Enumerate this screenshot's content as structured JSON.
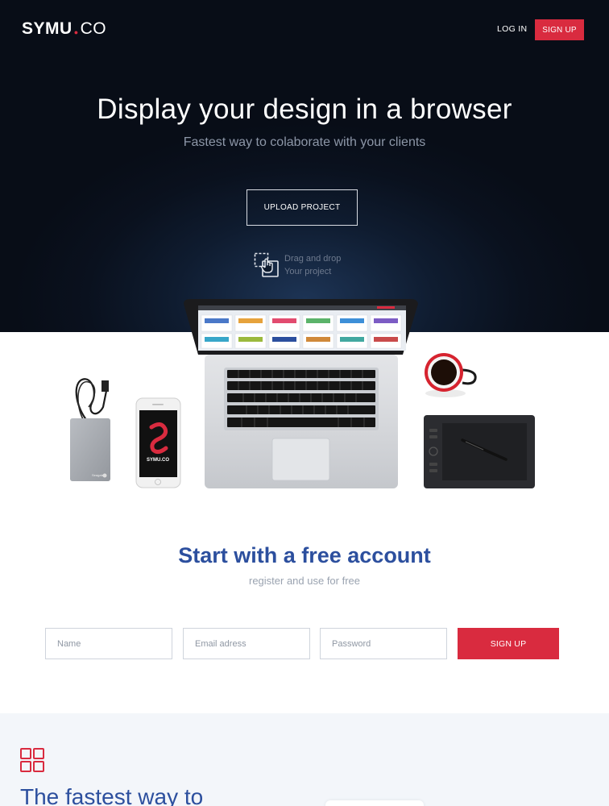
{
  "header": {
    "logo_main": "SYMU",
    "logo_dot": "●",
    "logo_suffix": "CO",
    "login_label": "LOG IN",
    "signup_label": "SIGN UP"
  },
  "hero": {
    "title": "Display your design in a browser",
    "subtitle": "Fastest way to colaborate with your clients",
    "upload_label": "UPLOAD PROJECT",
    "drag_line1": "Drag and drop",
    "drag_line2": "Your project",
    "drag_icon": "drag-drop-hand-icon"
  },
  "devices": {
    "phone_logo_text": "SYMU.CO",
    "drive_brand": "Seagate"
  },
  "signup": {
    "title_regular": "Start with a ",
    "title_bold": "free account",
    "subtitle": "register and use for free",
    "name_placeholder": "Name",
    "email_placeholder": "Email adress",
    "password_placeholder": "Password",
    "button_label": "SIGN UP"
  },
  "features": {
    "icon": "grid-icon",
    "title": "The fastest way to"
  },
  "colors": {
    "accent": "#d92b3f",
    "brand_blue": "#2c4f9e",
    "hero_bg": "#0a111e"
  }
}
